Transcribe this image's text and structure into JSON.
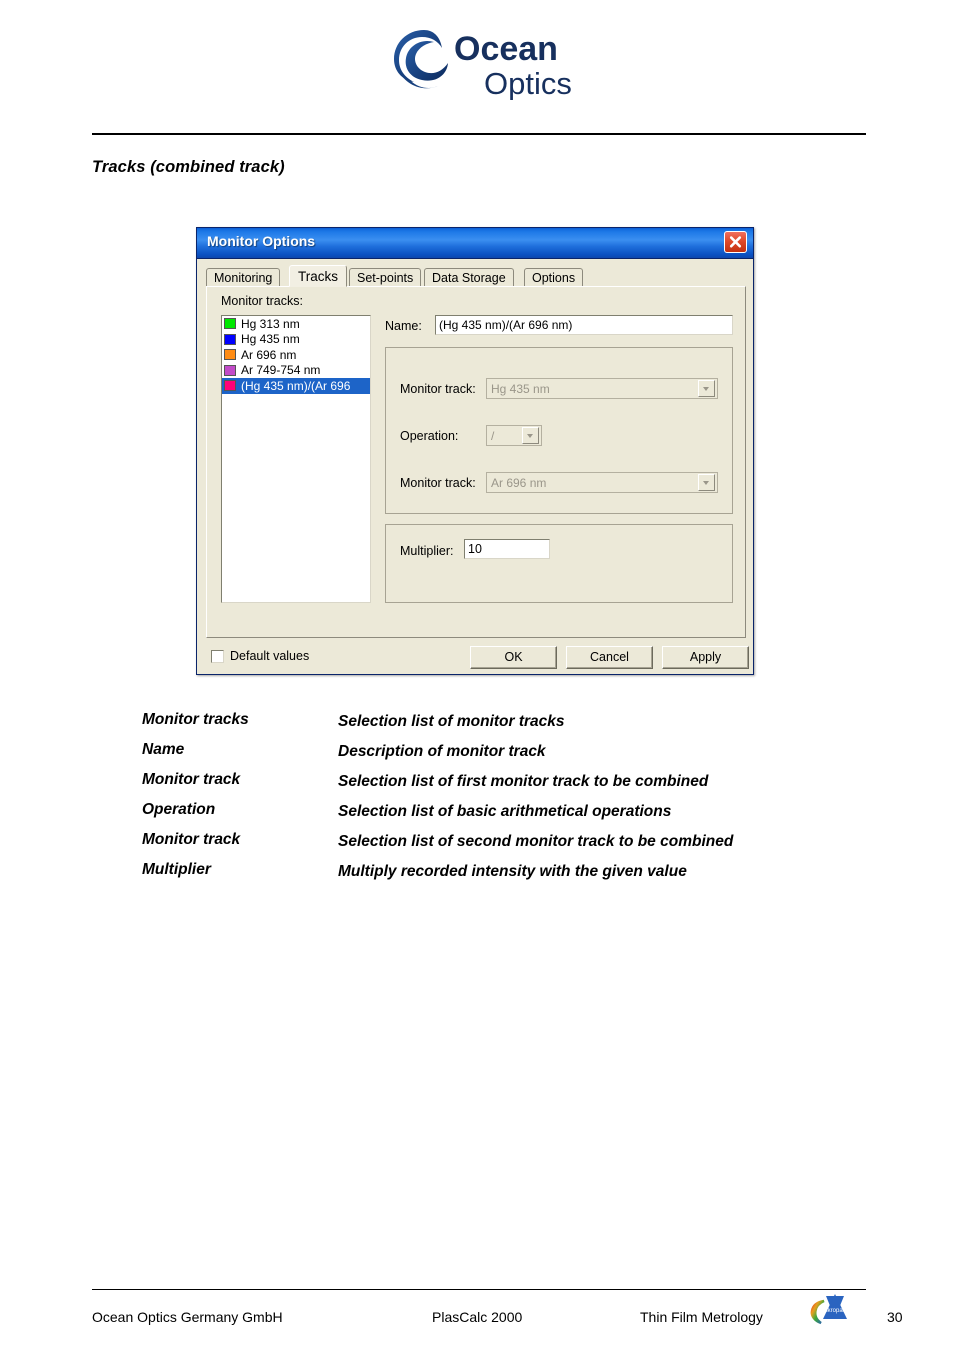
{
  "page": {
    "heading": "Tracks (combined track)",
    "brand": {
      "name_line1": "Ocean",
      "name_line2": "Optics",
      "logo_icon": "ocean-optics-swirl-logo",
      "color": "#1b3a73"
    }
  },
  "dialog": {
    "title": "Monitor Options",
    "close_icon": "close-icon",
    "tabs": [
      {
        "label": "Monitoring",
        "active": false
      },
      {
        "label": "Tracks",
        "active": true
      },
      {
        "label": "Set-points",
        "active": false
      },
      {
        "label": "Data Storage",
        "active": false
      },
      {
        "label": "Options",
        "active": false
      }
    ],
    "monitor_tracks_label": "Monitor tracks:",
    "tracks": [
      {
        "label": "Hg 313 nm",
        "color": "#00E800",
        "selected": false
      },
      {
        "label": "Hg 435 nm",
        "color": "#0000FF",
        "selected": false
      },
      {
        "label": "Ar 696 nm",
        "color": "#FF8C14",
        "selected": false
      },
      {
        "label": "Ar 749-754 nm",
        "color": "#C24BC8",
        "selected": false
      },
      {
        "label": "(Hg 435 nm)/(Ar 696",
        "color": "#FF0078",
        "selected": true
      }
    ],
    "name": {
      "label": "Name:",
      "value": "(Hg 435 nm)/(Ar 696 nm)",
      "placeholder": ""
    },
    "monitor_track_1": {
      "label": "Monitor track:",
      "value": "Hg 435 nm",
      "arrow_icon": "chevron-down-icon",
      "disabled": true
    },
    "operation": {
      "label": "Operation:",
      "value": "/",
      "arrow_icon": "chevron-down-icon",
      "disabled": true
    },
    "monitor_track_2": {
      "label": "Monitor track:",
      "value": "Ar 696 nm",
      "arrow_icon": "chevron-down-icon",
      "disabled": true
    },
    "multiplier": {
      "label": "Multiplier:",
      "value": "10",
      "placeholder": ""
    },
    "default_values": {
      "label": "Default values",
      "checked": false
    },
    "buttons": {
      "ok": "OK",
      "cancel": "Cancel",
      "apply": "Apply"
    },
    "colors": {
      "titlebar_start": "#1f7ae8",
      "titlebar_end": "#0d47ad",
      "face": "#ece9d8",
      "selection": "#1d64c8",
      "close_button": "#c33010"
    }
  },
  "definitions": [
    {
      "term": "Monitor tracks",
      "description": "Selection list of monitor tracks"
    },
    {
      "term": "Name",
      "description": "Description of monitor track"
    },
    {
      "term": "Monitor track",
      "description": "Selection list of first monitor track to be combined"
    },
    {
      "term": "Operation",
      "description": "Selection list of basic arithmetical operations"
    },
    {
      "term": "Monitor track",
      "description": "Selection list of second monitor track to be combined"
    },
    {
      "term": "Multiplier",
      "description": "Multiply recorded intensity with the given value"
    }
  ],
  "footer": {
    "company": "Ocean Optics Germany GmbH",
    "product": "PlasCalc 2000",
    "division": "Thin Film Metrology",
    "logo_icon": "mikropack-logo",
    "logo_text": "Mikropack",
    "page_number": "30"
  }
}
